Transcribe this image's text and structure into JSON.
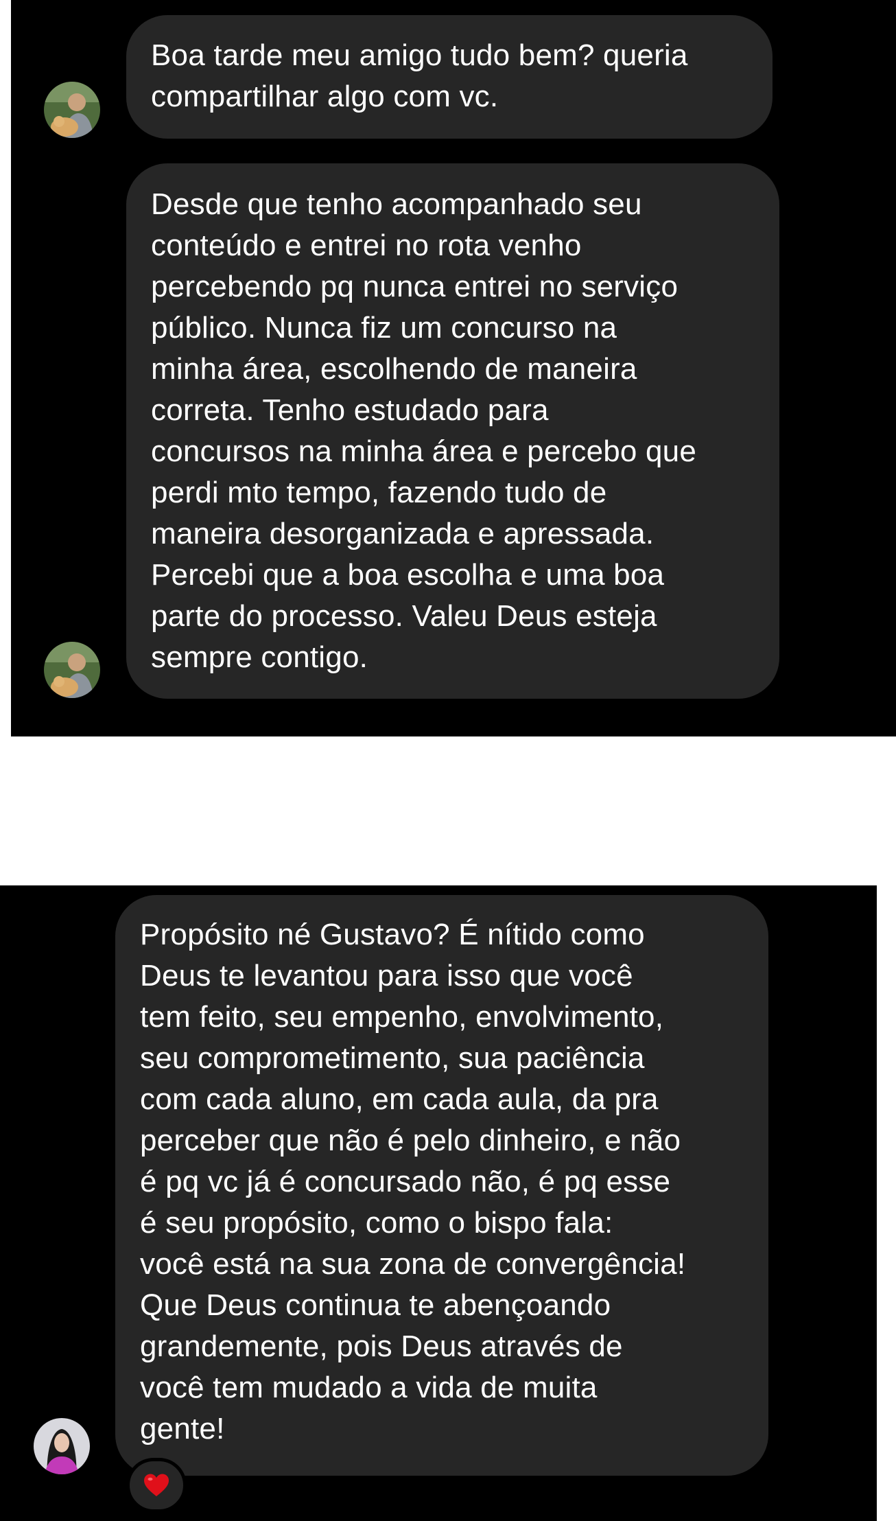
{
  "conversation_1": {
    "messages": [
      {
        "text": "Boa tarde meu amigo tudo bem? queria\ncompartilhar algo com vc."
      },
      {
        "text": "Desde que tenho acompanhado seu\nconteúdo e entrei no rota venho\npercebendo pq nunca entrei no serviço\npúblico. Nunca fiz um concurso na\nminha área, escolhendo de maneira\ncorreta. Tenho estudado para\nconcursos na minha área e percebo que\nperdi mto tempo, fazendo tudo de\nmaneira desorganizada e apressada.\nPercebi que a boa escolha e uma boa\nparte do processo. Valeu Deus esteja\nsempre contigo."
      }
    ]
  },
  "conversation_2": {
    "messages": [
      {
        "text": "Propósito né Gustavo? É nítido como\nDeus te levantou para isso que você\ntem feito, seu empenho, envolvimento,\nseu comprometimento, sua paciência\ncom cada aluno, em cada aula, da pra\nperceber que não é pelo dinheiro, e não\né pq vc já é concursado não, é pq esse\né seu propósito, como o bispo fala:\nvocê está na sua zona de convergência!\nQue Deus continua te abençoando\ngrandemente, pois Deus através de\nvocê tem mudado a vida de muita\ngente!"
      }
    ],
    "reaction": {
      "icon": "heart-icon",
      "color": "#e0101a"
    }
  },
  "colors": {
    "background": "#000000",
    "bubble": "#262626",
    "text": "#ffffff",
    "separator": "#ffffff"
  }
}
